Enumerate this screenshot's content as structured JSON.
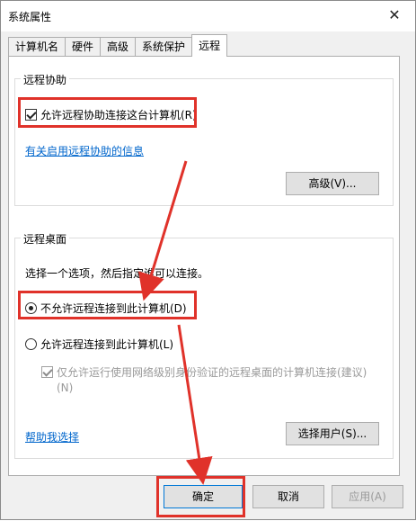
{
  "window": {
    "title": "系统属性",
    "close_label": "✕"
  },
  "tabs": [
    {
      "label": "计算机名",
      "active": false
    },
    {
      "label": "硬件",
      "active": false
    },
    {
      "label": "高级",
      "active": false
    },
    {
      "label": "系统保护",
      "active": false
    },
    {
      "label": "远程",
      "active": true
    }
  ],
  "remote_assistance": {
    "legend": "远程协助",
    "allow_checkbox": {
      "label": "允许远程协助连接这台计算机(R)",
      "checked": true
    },
    "info_link": "有关启用远程协助的信息",
    "advanced_button": "高级(V)..."
  },
  "remote_desktop": {
    "legend": "远程桌面",
    "instruction": "选择一个选项，然后指定谁可以连接。",
    "option_deny": {
      "label": "不允许远程连接到此计算机(D)",
      "checked": true
    },
    "option_allow": {
      "label": "允许远程连接到此计算机(L)",
      "checked": false
    },
    "nla_checkbox": {
      "line1": "仅允许运行使用网络级别身份验证的远程桌面的计算机连接(建议)",
      "line2": "(N)",
      "checked": true,
      "disabled": true
    },
    "help_link": "帮助我选择",
    "select_users_button": "选择用户(S)..."
  },
  "footer": {
    "ok_button": "确定",
    "cancel_button": "取消",
    "apply_button": "应用(A)"
  },
  "colors": {
    "annotation_red": "#e0322a",
    "link_blue": "#0066cc"
  }
}
